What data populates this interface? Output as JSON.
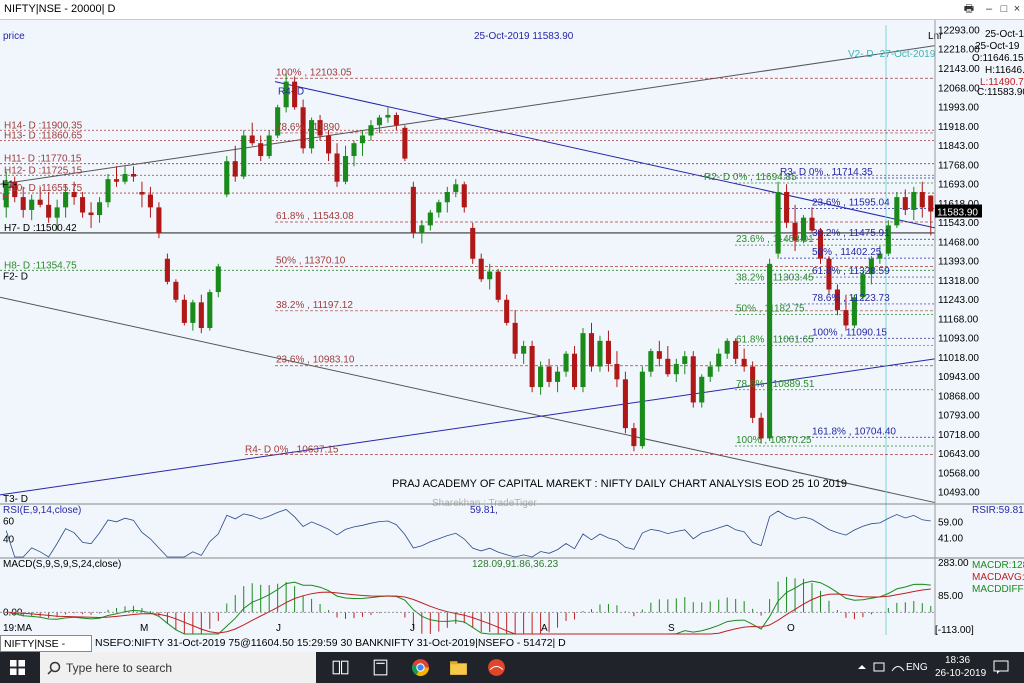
{
  "window": {
    "title": "NIFTY|NSE - 20000| D",
    "controls": [
      "🖶",
      "–",
      "□",
      "×"
    ]
  },
  "chart_header": {
    "price_label": "price",
    "date_price": "25-Oct-2019 11583.90",
    "mode": "Lnr"
  },
  "ohlc": {
    "date": "25-Oct-19",
    "date2": "25-Oct-19",
    "open": "O:11646.15",
    "high": "H:11646.90",
    "low": "L:11490.75",
    "close": "C:11583.90"
  },
  "current_price_tag": "11583.90",
  "vline_label": "V2- D -27-Oct-2019",
  "annotation_title": "PRAJ ACADEMY OF CAPITAL MAREKT : NIFTY DAILY CHART ANALYSIS EOD 25 10 2019",
  "watermark": "Sharekhan : TradeTiger",
  "price_axis_ticks": [
    "12293.00",
    "12218.00",
    "12143.00",
    "12068.00",
    "11993.00",
    "11918.00",
    "11843.00",
    "11768.00",
    "11693.00",
    "11618.00",
    "11543.00",
    "11468.00",
    "11393.00",
    "11318.00",
    "11243.00",
    "11168.00",
    "11093.00",
    "11018.00",
    "10943.00",
    "10868.00",
    "10793.00",
    "10718.00",
    "10643.00",
    "10568.00",
    "10493.00"
  ],
  "hlines_left": [
    {
      "label": "H14- D :11900.35",
      "price": 11900.35
    },
    {
      "label": "H13- D :11860.65",
      "price": 11860.65
    },
    {
      "label": "H11- D :11770.15",
      "price": 11770.15
    },
    {
      "label": "H12- D :11725.15",
      "price": 11725.15
    },
    {
      "label": "H10- D :11655.75",
      "price": 11655.75
    },
    {
      "label": "H7- D :11500.42",
      "price": 11500.42
    },
    {
      "label": "H8- D :11354.75",
      "price": 11354.75
    }
  ],
  "hlines_extra_labels": [
    "F1-",
    "H"
  ],
  "fib_red": [
    {
      "label": "100%   , 12103.05",
      "price": 12103.05
    },
    {
      "label": "78.6%   , 11890",
      "price": 11890
    },
    {
      "label": "61.8%   , 11543.08",
      "price": 11543.08
    },
    {
      "label": "50%   , 11370.10",
      "price": 11370.1
    },
    {
      "label": "38.2%   , 11197.12",
      "price": 11197.12
    },
    {
      "label": "23.6%   , 10983.10",
      "price": 10983.1
    }
  ],
  "fib_red_bottom": {
    "label": "R4- D  0%   , 10637.15",
    "price": 10637.15
  },
  "fib_top_label": "R4- D",
  "fib_green": [
    {
      "label": "R2- D  0%   , 11694.85",
      "price": 11694.85
    },
    {
      "label": "23.6%   , 11453.01",
      "price": 11453.01
    },
    {
      "label": "38.2%   , 11303.45",
      "price": 11303.45
    },
    {
      "label": "50%   , 11182.75",
      "price": 11182.75
    },
    {
      "label": "61.8%   , 11061.65",
      "price": 11061.65
    },
    {
      "label": "78.6%   , 10889.51",
      "price": 10889.51
    },
    {
      "label": "100%   , 10670.25",
      "price": 10670.25
    }
  ],
  "fib_blue": [
    {
      "label": "R3- D  0%   , 11714.35",
      "price": 11714.35
    },
    {
      "label": "23.6%   , 11595.04",
      "price": 11595.04
    },
    {
      "label": "38.2%   , 11475.91",
      "price": 11475.91
    },
    {
      "label": "50%   , 11402.25",
      "price": 11402.25
    },
    {
      "label": "61.8%   , 11328.59",
      "price": 11328.59
    },
    {
      "label": "78.6%   , 11223.73",
      "price": 11223.73
    },
    {
      "label": "100%   , 11090.15",
      "price": 11090.15
    },
    {
      "label": "161.8%   , 10704.40",
      "price": 10704.4
    }
  ],
  "trend_labels": {
    "f2": "F2- D",
    "t3": "T3- D"
  },
  "rsi": {
    "title": "RSI(E,9,14,close)",
    "value": "59.81,",
    "right_label": "RSIR:59.81",
    "axis": [
      "59.00",
      "41.00"
    ],
    "left_levels": [
      "60",
      "40"
    ]
  },
  "macd": {
    "title": "MACD(S,9,S,9,S,24,close)",
    "values": "128.09,91.86,36.23",
    "left_level": "0.00",
    "axis": [
      "283.00",
      "85.00",
      "[-113.00]"
    ],
    "legend": [
      "MACDR:128",
      "MACDAVG:",
      "MACDDIFF:"
    ]
  },
  "x_axis_labels": [
    "19:MA",
    "M",
    "J",
    "J",
    "A",
    "S",
    "O"
  ],
  "chart_tabs": {
    "active": "NIFTY|NSE - 20000| D",
    "other": "NSEFO:NIFTY 31-Oct-2019 75@11604.50 15:29:59 30  BANKNIFTY 31-Oct-2019|NSEFO - 51472| D"
  },
  "taskbar": {
    "search_placeholder": "Type here to search",
    "lang": "ENG",
    "time": "18:36",
    "date": "26-10-2019"
  },
  "colors": {
    "bg": "#f0f6fc",
    "up": "#1a8a1a",
    "down": "#b01818",
    "red_line": "#a23c3c",
    "green_line": "#2e8b2e",
    "blue_line": "#2727a8"
  },
  "chart_data": {
    "type": "candlestick",
    "title": "NIFTY|NSE - 20000| D",
    "ylim": [
      10460,
      12330
    ],
    "ohlc": [
      [
        11600,
        11740,
        11560,
        11700
      ],
      [
        11700,
        11720,
        11620,
        11640
      ],
      [
        11640,
        11680,
        11560,
        11590
      ],
      [
        11590,
        11650,
        11550,
        11630
      ],
      [
        11630,
        11680,
        11600,
        11610
      ],
      [
        11610,
        11660,
        11540,
        11560
      ],
      [
        11560,
        11630,
        11510,
        11600
      ],
      [
        11600,
        11690,
        11560,
        11660
      ],
      [
        11660,
        11700,
        11610,
        11640
      ],
      [
        11640,
        11660,
        11560,
        11580
      ],
      [
        11580,
        11620,
        11520,
        11570
      ],
      [
        11570,
        11640,
        11540,
        11620
      ],
      [
        11620,
        11730,
        11600,
        11710
      ],
      [
        11710,
        11760,
        11680,
        11700
      ],
      [
        11700,
        11760,
        11690,
        11730
      ],
      [
        11730,
        11760,
        11700,
        11720
      ],
      [
        11660,
        11700,
        11600,
        11650
      ],
      [
        11650,
        11680,
        11560,
        11600
      ],
      [
        11600,
        11620,
        11480,
        11500
      ],
      [
        11400,
        11420,
        11300,
        11310
      ],
      [
        11310,
        11320,
        11230,
        11240
      ],
      [
        11240,
        11260,
        11140,
        11150
      ],
      [
        11150,
        11240,
        11120,
        11230
      ],
      [
        11230,
        11260,
        11110,
        11130
      ],
      [
        11130,
        11280,
        11120,
        11270
      ],
      [
        11270,
        11380,
        11250,
        11370
      ],
      [
        11650,
        11800,
        11640,
        11780
      ],
      [
        11780,
        11840,
        11700,
        11720
      ],
      [
        11720,
        11900,
        11710,
        11880
      ],
      [
        11880,
        11930,
        11840,
        11850
      ],
      [
        11850,
        11880,
        11780,
        11800
      ],
      [
        11800,
        11900,
        11790,
        11880
      ],
      [
        11880,
        12000,
        11870,
        11990
      ],
      [
        11990,
        12120,
        11970,
        12090
      ],
      [
        12090,
        12110,
        11980,
        11990
      ],
      [
        11990,
        12020,
        11810,
        11830
      ],
      [
        11830,
        11950,
        11810,
        11940
      ],
      [
        11940,
        11960,
        11860,
        11880
      ],
      [
        11880,
        11900,
        11780,
        11810
      ],
      [
        11810,
        11850,
        11680,
        11700
      ],
      [
        11700,
        11840,
        11690,
        11800
      ],
      [
        11800,
        11860,
        11760,
        11850
      ],
      [
        11850,
        11900,
        11800,
        11880
      ],
      [
        11880,
        11940,
        11860,
        11920
      ],
      [
        11920,
        11960,
        11890,
        11950
      ],
      [
        11950,
        11990,
        11930,
        11960
      ],
      [
        11960,
        11970,
        11900,
        11920
      ],
      [
        11910,
        11920,
        11780,
        11790
      ],
      [
        11680,
        11700,
        11480,
        11500
      ],
      [
        11500,
        11550,
        11460,
        11530
      ],
      [
        11530,
        11590,
        11510,
        11580
      ],
      [
        11580,
        11630,
        11560,
        11620
      ],
      [
        11620,
        11680,
        11580,
        11660
      ],
      [
        11660,
        11710,
        11640,
        11690
      ],
      [
        11690,
        11700,
        11580,
        11600
      ],
      [
        11520,
        11540,
        11380,
        11400
      ],
      [
        11400,
        11420,
        11310,
        11320
      ],
      [
        11320,
        11380,
        11280,
        11350
      ],
      [
        11350,
        11360,
        11230,
        11240
      ],
      [
        11240,
        11260,
        11140,
        11150
      ],
      [
        11150,
        11200,
        11010,
        11030
      ],
      [
        11030,
        11080,
        10990,
        11060
      ],
      [
        11060,
        11080,
        10880,
        10900
      ],
      [
        10900,
        11000,
        10870,
        10980
      ],
      [
        10980,
        11010,
        10900,
        10920
      ],
      [
        10920,
        10980,
        10880,
        10960
      ],
      [
        10960,
        11040,
        10940,
        11030
      ],
      [
        11030,
        11060,
        10890,
        10900
      ],
      [
        10900,
        11130,
        10880,
        11110
      ],
      [
        11110,
        11150,
        10960,
        10980
      ],
      [
        10980,
        11100,
        10960,
        11080
      ],
      [
        11080,
        11120,
        10960,
        10990
      ],
      [
        10990,
        11040,
        10900,
        10930
      ],
      [
        10930,
        10960,
        10720,
        10740
      ],
      [
        10740,
        10760,
        10650,
        10670
      ],
      [
        10670,
        10980,
        10660,
        10960
      ],
      [
        10960,
        11050,
        10940,
        11040
      ],
      [
        11040,
        11080,
        10980,
        11010
      ],
      [
        11010,
        11060,
        10940,
        10950
      ],
      [
        10950,
        11010,
        10920,
        10990
      ],
      [
        10990,
        11040,
        10950,
        11020
      ],
      [
        11020,
        11040,
        10820,
        10840
      ],
      [
        10840,
        10950,
        10820,
        10940
      ],
      [
        10940,
        11000,
        10920,
        10980
      ],
      [
        10980,
        11050,
        10960,
        11030
      ],
      [
        11030,
        11090,
        11010,
        11080
      ],
      [
        11080,
        11090,
        10990,
        11010
      ],
      [
        11010,
        11050,
        10960,
        10980
      ],
      [
        10980,
        11000,
        10760,
        10780
      ],
      [
        10780,
        10800,
        10680,
        10700
      ],
      [
        10700,
        11400,
        10690,
        11380
      ],
      [
        11420,
        11700,
        11400,
        11660
      ],
      [
        11660,
        11690,
        11520,
        11540
      ],
      [
        11540,
        11610,
        11430,
        11470
      ],
      [
        11470,
        11570,
        11460,
        11560
      ],
      [
        11560,
        11600,
        11500,
        11510
      ],
      [
        11510,
        11520,
        11380,
        11400
      ],
      [
        11400,
        11410,
        11260,
        11280
      ],
      [
        11280,
        11300,
        11180,
        11200
      ],
      [
        11200,
        11260,
        11120,
        11140
      ],
      [
        11140,
        11260,
        11130,
        11250
      ],
      [
        11250,
        11350,
        11240,
        11340
      ],
      [
        11340,
        11410,
        11300,
        11400
      ],
      [
        11400,
        11450,
        11380,
        11420
      ],
      [
        11420,
        11550,
        11410,
        11530
      ],
      [
        11530,
        11660,
        11520,
        11640
      ],
      [
        11640,
        11670,
        11570,
        11590
      ],
      [
        11590,
        11680,
        11550,
        11660
      ],
      [
        11660,
        11700,
        11560,
        11600
      ],
      [
        11646.15,
        11646.9,
        11490.75,
        11583.9
      ]
    ],
    "rsi_range": [
      20,
      80
    ],
    "macd_range": [
      -113,
      283
    ],
    "x_labels": [
      "19:MA",
      "M",
      "J",
      "J",
      "A",
      "S",
      "O"
    ]
  }
}
